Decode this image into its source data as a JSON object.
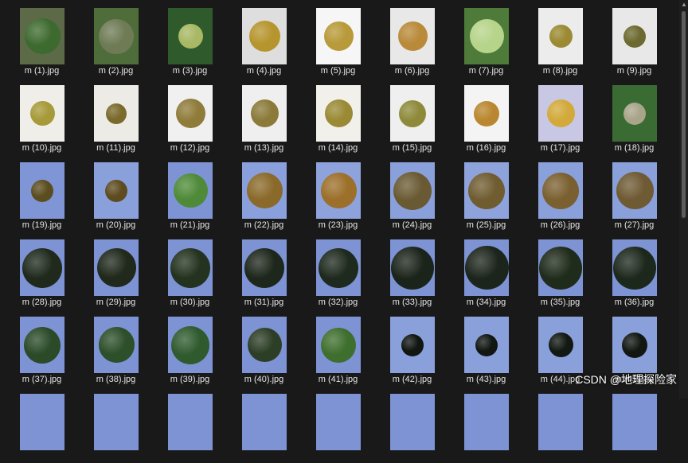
{
  "watermark": "CSDN @地理探险家",
  "icons": {
    "scroll_up": "triangle-up-icon"
  },
  "files": [
    {
      "name": "m (1).jpg",
      "bg": "#5d6a48",
      "fruit": "#3d6a2f",
      "size": 0.8
    },
    {
      "name": "m (2).jpg",
      "bg": "#4f6d3a",
      "fruit": "#6f7b55",
      "size": 0.78
    },
    {
      "name": "m (3).jpg",
      "bg": "#2f5a2c",
      "fruit": "#a8b864",
      "size": 0.55
    },
    {
      "name": "m (4).jpg",
      "bg": "#dedede",
      "fruit": "#b6952e",
      "size": 0.7
    },
    {
      "name": "m (5).jpg",
      "bg": "#f6f6f6",
      "fruit": "#b89a3a",
      "size": 0.66
    },
    {
      "name": "m (6).jpg",
      "bg": "#e8e8e8",
      "fruit": "#b98a3a",
      "size": 0.66
    },
    {
      "name": "m (7).jpg",
      "bg": "#4e7a3a",
      "fruit": "#b6d48a",
      "size": 0.76
    },
    {
      "name": "m (8).jpg",
      "bg": "#ececec",
      "fruit": "#9b8a33",
      "size": 0.52
    },
    {
      "name": "m (9).jpg",
      "bg": "#e8e8e8",
      "fruit": "#6c6a30",
      "size": 0.5
    },
    {
      "name": "m (10).jpg",
      "bg": "#f0eee8",
      "fruit": "#a69a3a",
      "size": 0.56
    },
    {
      "name": "m (11).jpg",
      "bg": "#ecebe6",
      "fruit": "#7a6a2c",
      "size": 0.46
    },
    {
      "name": "m (12).jpg",
      "bg": "#f0f0f0",
      "fruit": "#8f7b3a",
      "size": 0.66
    },
    {
      "name": "m (13).jpg",
      "bg": "#efefef",
      "fruit": "#8b7a3a",
      "size": 0.62
    },
    {
      "name": "m (14).jpg",
      "bg": "#f2f0ea",
      "fruit": "#9a8a35",
      "size": 0.62
    },
    {
      "name": "m (15).jpg",
      "bg": "#efefef",
      "fruit": "#8e8a3a",
      "size": 0.6
    },
    {
      "name": "m (16).jpg",
      "bg": "#f4f4f4",
      "fruit": "#b9872f",
      "size": 0.58
    },
    {
      "name": "m (17).jpg",
      "bg": "#c9c8e4",
      "fruit": "#d2a93a",
      "size": 0.62
    },
    {
      "name": "m (18).jpg",
      "bg": "#3a6b33",
      "fruit": "#a9a58a",
      "size": 0.5
    },
    {
      "name": "m (19).jpg",
      "bg": "#7f95d6",
      "fruit": "#5c4d1e",
      "size": 0.5
    },
    {
      "name": "m (20).jpg",
      "bg": "#8aa0da",
      "fruit": "#5e4b20",
      "size": 0.5
    },
    {
      "name": "m (21).jpg",
      "bg": "#7d93d4",
      "fruit": "#4f8a38",
      "size": 0.76
    },
    {
      "name": "m (22).jpg",
      "bg": "#8aa0dc",
      "fruit": "#8a6a2a",
      "size": 0.8
    },
    {
      "name": "m (23).jpg",
      "bg": "#8ea3dc",
      "fruit": "#9c6f2a",
      "size": 0.8
    },
    {
      "name": "m (24).jpg",
      "bg": "#8aa0da",
      "fruit": "#6a5a33",
      "size": 0.86
    },
    {
      "name": "m (25).jpg",
      "bg": "#8ea3dc",
      "fruit": "#6f5c30",
      "size": 0.82
    },
    {
      "name": "m (26).jpg",
      "bg": "#8aa0da",
      "fruit": "#7a6030",
      "size": 0.82
    },
    {
      "name": "m (27).jpg",
      "bg": "#8aa0da",
      "fruit": "#6e5a33",
      "size": 0.84
    },
    {
      "name": "m (28).jpg",
      "bg": "#7d93d4",
      "fruit": "#1f2a1d",
      "size": 0.9
    },
    {
      "name": "m (29).jpg",
      "bg": "#7d93d4",
      "fruit": "#20291c",
      "size": 0.88
    },
    {
      "name": "m (30).jpg",
      "bg": "#7d93d4",
      "fruit": "#24331f",
      "size": 0.9
    },
    {
      "name": "m (31).jpg",
      "bg": "#7d93d4",
      "fruit": "#1e271c",
      "size": 0.9
    },
    {
      "name": "m (32).jpg",
      "bg": "#7d93d4",
      "fruit": "#1f2a1e",
      "size": 0.9
    },
    {
      "name": "m (33).jpg",
      "bg": "#7d93d4",
      "fruit": "#1b241a",
      "size": 0.96
    },
    {
      "name": "m (34).jpg",
      "bg": "#7d93d4",
      "fruit": "#1c251b",
      "size": 0.98
    },
    {
      "name": "m (35).jpg",
      "bg": "#7d93d4",
      "fruit": "#1f2b1b",
      "size": 0.96
    },
    {
      "name": "m (36).jpg",
      "bg": "#7d93d4",
      "fruit": "#1d281c",
      "size": 0.96
    },
    {
      "name": "m (37).jpg",
      "bg": "#7d93d4",
      "fruit": "#2a4a28",
      "size": 0.82
    },
    {
      "name": "m (38).jpg",
      "bg": "#7d93d4",
      "fruit": "#2d4f2a",
      "size": 0.8
    },
    {
      "name": "m (39).jpg",
      "bg": "#7d93d4",
      "fruit": "#2f5a2e",
      "size": 0.86
    },
    {
      "name": "m (40).jpg",
      "bg": "#7d93d4",
      "fruit": "#2c3e26",
      "size": 0.76
    },
    {
      "name": "m (41).jpg",
      "bg": "#7d93d4",
      "fruit": "#3f6f2e",
      "size": 0.78
    },
    {
      "name": "m (42).jpg",
      "bg": "#8aa0da",
      "fruit": "#111611",
      "size": 0.5
    },
    {
      "name": "m (43).jpg",
      "bg": "#8aa0da",
      "fruit": "#121712",
      "size": 0.5
    },
    {
      "name": "m (44).jpg",
      "bg": "#8aa0da",
      "fruit": "#121812",
      "size": 0.55
    },
    {
      "name": "m (45).jpg",
      "bg": "#8aa0da",
      "fruit": "#121712",
      "size": 0.58
    },
    {
      "name": "",
      "bg": "#7d93d4",
      "fruit": "#7d93d4",
      "size": 0
    },
    {
      "name": "",
      "bg": "#7d93d4",
      "fruit": "#7d93d4",
      "size": 0
    },
    {
      "name": "",
      "bg": "#7d93d4",
      "fruit": "#7d93d4",
      "size": 0
    },
    {
      "name": "",
      "bg": "#7d93d4",
      "fruit": "#7d93d4",
      "size": 0
    },
    {
      "name": "",
      "bg": "#7d93d4",
      "fruit": "#7d93d4",
      "size": 0
    },
    {
      "name": "",
      "bg": "#7d93d4",
      "fruit": "#7d93d4",
      "size": 0
    },
    {
      "name": "",
      "bg": "#7d93d4",
      "fruit": "#7d93d4",
      "size": 0
    },
    {
      "name": "",
      "bg": "#7d93d4",
      "fruit": "#7d93d4",
      "size": 0
    },
    {
      "name": "",
      "bg": "#7d93d4",
      "fruit": "#7d93d4",
      "size": 0
    }
  ]
}
